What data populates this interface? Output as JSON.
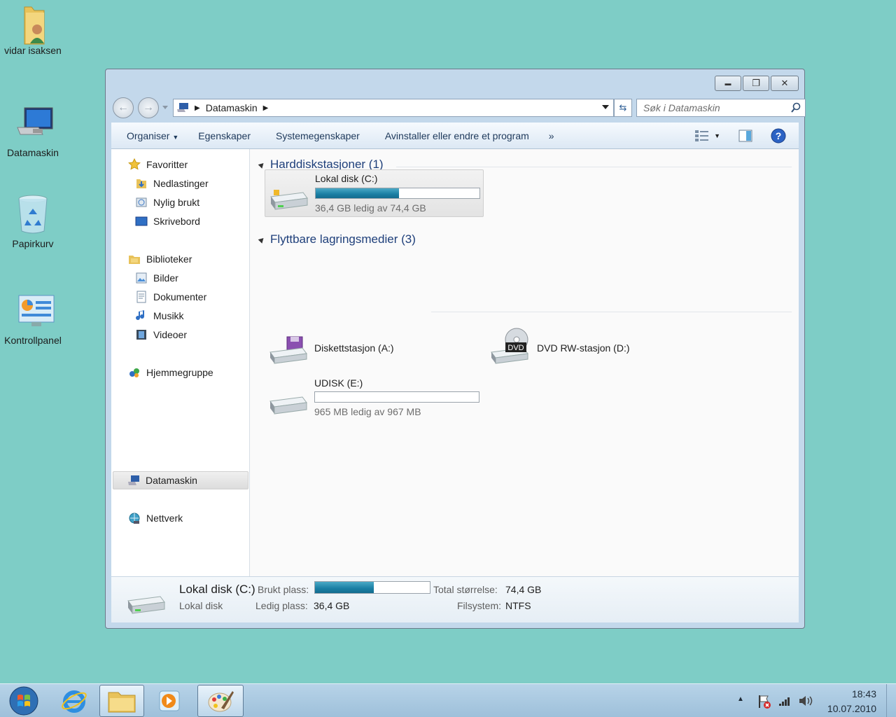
{
  "desktop": {
    "icons": [
      {
        "label": "vidar isaksen",
        "icon": "user-folder-icon"
      },
      {
        "label": "Datamaskin",
        "icon": "computer-icon"
      },
      {
        "label": "Papirkurv",
        "icon": "recycle-bin-icon"
      },
      {
        "label": "Kontrollpanel",
        "icon": "control-panel-icon"
      }
    ]
  },
  "window": {
    "caption_buttons": {
      "minimize": "▬",
      "restore": "❐",
      "close": "✕"
    },
    "address": {
      "crumb": "Datamaskin"
    },
    "search": {
      "placeholder": "Søk i Datamaskin"
    },
    "toolbar": {
      "organize": "Organiser",
      "properties": "Egenskaper",
      "system_properties": "Systemegenskaper",
      "uninstall": "Avinstaller eller endre et program",
      "more": "»"
    },
    "nav": {
      "favorites": "Favoritter",
      "downloads": "Nedlastinger",
      "recent": "Nylig brukt",
      "desktop": "Skrivebord",
      "libraries": "Biblioteker",
      "pictures": "Bilder",
      "documents": "Dokumenter",
      "music": "Musikk",
      "videos": "Videoer",
      "homegroup": "Hjemmegruppe",
      "computer": "Datamaskin",
      "network": "Nettverk"
    },
    "groups": {
      "hdd": "Harddiskstasjoner (1)",
      "removable": "Flyttbare lagringsmedier (3)"
    },
    "drives": {
      "c": {
        "name": "Lokal disk (C:)",
        "info": "36,4 GB ledig av 74,4 GB",
        "used_fraction": 0.51
      },
      "a": {
        "name": "Diskettstasjon (A:)"
      },
      "d": {
        "name": "DVD RW-stasjon (D:)",
        "badge": "DVD"
      },
      "e": {
        "name": "UDISK (E:)",
        "info": "965 MB ledig av 967 MB",
        "used_fraction": 0.002
      }
    },
    "details": {
      "title": "Lokal disk (C:)",
      "subtitle": "Lokal disk",
      "used_label": "Brukt plass:",
      "free_label": "Ledig plass:",
      "free_value": "36,4 GB",
      "total_label": "Total størrelse:",
      "total_value": "74,4 GB",
      "fs_label": "Filsystem:",
      "fs_value": "NTFS",
      "used_fraction": 0.51
    }
  },
  "taskbar": {
    "time": "18:43",
    "date": "10.07.2010",
    "tray_arrow": "▲"
  },
  "colors": {
    "desktop": "#7ecdc6",
    "accent_text": "#1e3f7a",
    "bar_fill": "#1a7ea3"
  }
}
